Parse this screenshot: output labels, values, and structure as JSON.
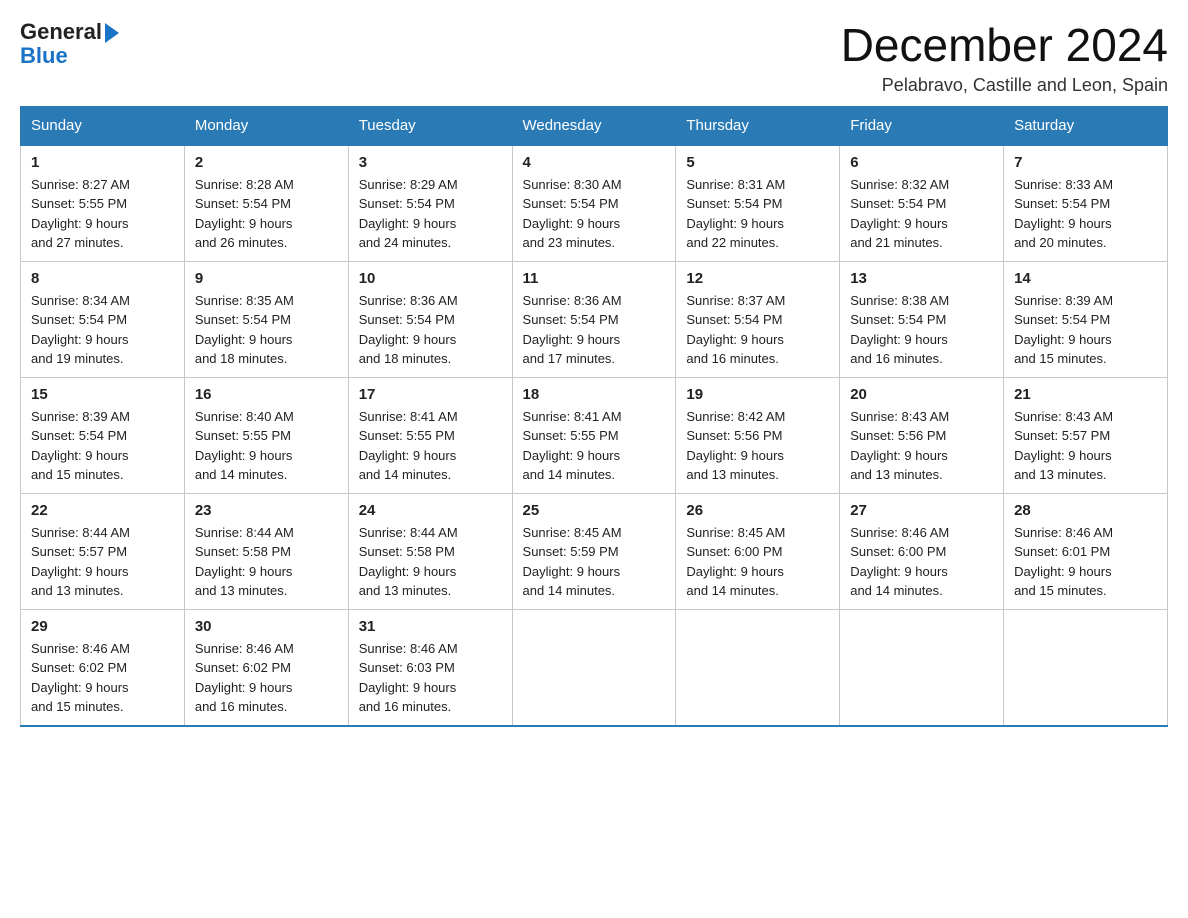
{
  "header": {
    "logo_general": "General",
    "logo_arrow": "",
    "logo_blue": "Blue",
    "month_year": "December 2024",
    "location": "Pelabravo, Castille and Leon, Spain"
  },
  "weekdays": [
    "Sunday",
    "Monday",
    "Tuesday",
    "Wednesday",
    "Thursday",
    "Friday",
    "Saturday"
  ],
  "weeks": [
    [
      {
        "day": "1",
        "sunrise": "8:27 AM",
        "sunset": "5:55 PM",
        "daylight": "9 hours and 27 minutes."
      },
      {
        "day": "2",
        "sunrise": "8:28 AM",
        "sunset": "5:54 PM",
        "daylight": "9 hours and 26 minutes."
      },
      {
        "day": "3",
        "sunrise": "8:29 AM",
        "sunset": "5:54 PM",
        "daylight": "9 hours and 24 minutes."
      },
      {
        "day": "4",
        "sunrise": "8:30 AM",
        "sunset": "5:54 PM",
        "daylight": "9 hours and 23 minutes."
      },
      {
        "day": "5",
        "sunrise": "8:31 AM",
        "sunset": "5:54 PM",
        "daylight": "9 hours and 22 minutes."
      },
      {
        "day": "6",
        "sunrise": "8:32 AM",
        "sunset": "5:54 PM",
        "daylight": "9 hours and 21 minutes."
      },
      {
        "day": "7",
        "sunrise": "8:33 AM",
        "sunset": "5:54 PM",
        "daylight": "9 hours and 20 minutes."
      }
    ],
    [
      {
        "day": "8",
        "sunrise": "8:34 AM",
        "sunset": "5:54 PM",
        "daylight": "9 hours and 19 minutes."
      },
      {
        "day": "9",
        "sunrise": "8:35 AM",
        "sunset": "5:54 PM",
        "daylight": "9 hours and 18 minutes."
      },
      {
        "day": "10",
        "sunrise": "8:36 AM",
        "sunset": "5:54 PM",
        "daylight": "9 hours and 18 minutes."
      },
      {
        "day": "11",
        "sunrise": "8:36 AM",
        "sunset": "5:54 PM",
        "daylight": "9 hours and 17 minutes."
      },
      {
        "day": "12",
        "sunrise": "8:37 AM",
        "sunset": "5:54 PM",
        "daylight": "9 hours and 16 minutes."
      },
      {
        "day": "13",
        "sunrise": "8:38 AM",
        "sunset": "5:54 PM",
        "daylight": "9 hours and 16 minutes."
      },
      {
        "day": "14",
        "sunrise": "8:39 AM",
        "sunset": "5:54 PM",
        "daylight": "9 hours and 15 minutes."
      }
    ],
    [
      {
        "day": "15",
        "sunrise": "8:39 AM",
        "sunset": "5:54 PM",
        "daylight": "9 hours and 15 minutes."
      },
      {
        "day": "16",
        "sunrise": "8:40 AM",
        "sunset": "5:55 PM",
        "daylight": "9 hours and 14 minutes."
      },
      {
        "day": "17",
        "sunrise": "8:41 AM",
        "sunset": "5:55 PM",
        "daylight": "9 hours and 14 minutes."
      },
      {
        "day": "18",
        "sunrise": "8:41 AM",
        "sunset": "5:55 PM",
        "daylight": "9 hours and 14 minutes."
      },
      {
        "day": "19",
        "sunrise": "8:42 AM",
        "sunset": "5:56 PM",
        "daylight": "9 hours and 13 minutes."
      },
      {
        "day": "20",
        "sunrise": "8:43 AM",
        "sunset": "5:56 PM",
        "daylight": "9 hours and 13 minutes."
      },
      {
        "day": "21",
        "sunrise": "8:43 AM",
        "sunset": "5:57 PM",
        "daylight": "9 hours and 13 minutes."
      }
    ],
    [
      {
        "day": "22",
        "sunrise": "8:44 AM",
        "sunset": "5:57 PM",
        "daylight": "9 hours and 13 minutes."
      },
      {
        "day": "23",
        "sunrise": "8:44 AM",
        "sunset": "5:58 PM",
        "daylight": "9 hours and 13 minutes."
      },
      {
        "day": "24",
        "sunrise": "8:44 AM",
        "sunset": "5:58 PM",
        "daylight": "9 hours and 13 minutes."
      },
      {
        "day": "25",
        "sunrise": "8:45 AM",
        "sunset": "5:59 PM",
        "daylight": "9 hours and 14 minutes."
      },
      {
        "day": "26",
        "sunrise": "8:45 AM",
        "sunset": "6:00 PM",
        "daylight": "9 hours and 14 minutes."
      },
      {
        "day": "27",
        "sunrise": "8:46 AM",
        "sunset": "6:00 PM",
        "daylight": "9 hours and 14 minutes."
      },
      {
        "day": "28",
        "sunrise": "8:46 AM",
        "sunset": "6:01 PM",
        "daylight": "9 hours and 15 minutes."
      }
    ],
    [
      {
        "day": "29",
        "sunrise": "8:46 AM",
        "sunset": "6:02 PM",
        "daylight": "9 hours and 15 minutes."
      },
      {
        "day": "30",
        "sunrise": "8:46 AM",
        "sunset": "6:02 PM",
        "daylight": "9 hours and 16 minutes."
      },
      {
        "day": "31",
        "sunrise": "8:46 AM",
        "sunset": "6:03 PM",
        "daylight": "9 hours and 16 minutes."
      },
      null,
      null,
      null,
      null
    ]
  ]
}
